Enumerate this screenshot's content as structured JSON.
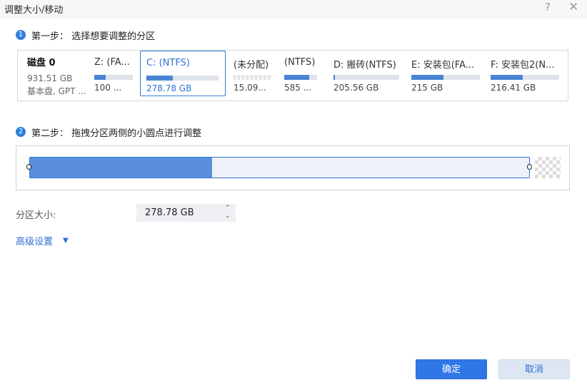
{
  "window": {
    "title": "调整大小/移动",
    "help_glyph": "?",
    "close_glyph": "✕"
  },
  "step1": {
    "number": "1",
    "label": "第一步： 选择想要调整的分区"
  },
  "disk": {
    "name": "磁盘 0",
    "size": "931.51 GB",
    "type": "基本盘, GPT ..."
  },
  "partitions": [
    {
      "label": "Z: (FA...",
      "size": "100 ...",
      "used_fraction": 0.3,
      "unallocated": false,
      "selected": false
    },
    {
      "label": "C: (NTFS)",
      "size": "278.78 GB",
      "used_fraction": 0.37,
      "unallocated": false,
      "selected": true
    },
    {
      "label": "(未分配)",
      "size": "15.09...",
      "used_fraction": 0,
      "unallocated": true,
      "selected": false
    },
    {
      "label": "(NTFS)",
      "size": "585 ...",
      "used_fraction": 0.75,
      "unallocated": false,
      "selected": false
    },
    {
      "label": "D: 搬砖(NTFS)",
      "size": "205.56 GB",
      "used_fraction": 0.02,
      "unallocated": false,
      "selected": false
    },
    {
      "label": "E: 安装包(FA...",
      "size": "215 GB",
      "used_fraction": 0.47,
      "unallocated": false,
      "selected": false
    },
    {
      "label": "F: 安装包2(N...",
      "size": "216.41 GB",
      "used_fraction": 0.47,
      "unallocated": false,
      "selected": false
    }
  ],
  "step2": {
    "number": "2",
    "label": "第二步： 拖拽分区两侧的小圆点进行调整"
  },
  "resize": {
    "used_fraction": 0.365
  },
  "partition_size": {
    "label": "分区大小:",
    "value": "278.78 GB",
    "up_glyph": "⌃",
    "down_glyph": "⌄"
  },
  "advanced": {
    "label": "高级设置",
    "arrow_glyph": "▼"
  },
  "buttons": {
    "ok": "确定",
    "cancel": "取消"
  },
  "colors": {
    "accent": "#2f77e6",
    "used_bar": "#4a83d4",
    "selected_border": "#3478d6"
  }
}
